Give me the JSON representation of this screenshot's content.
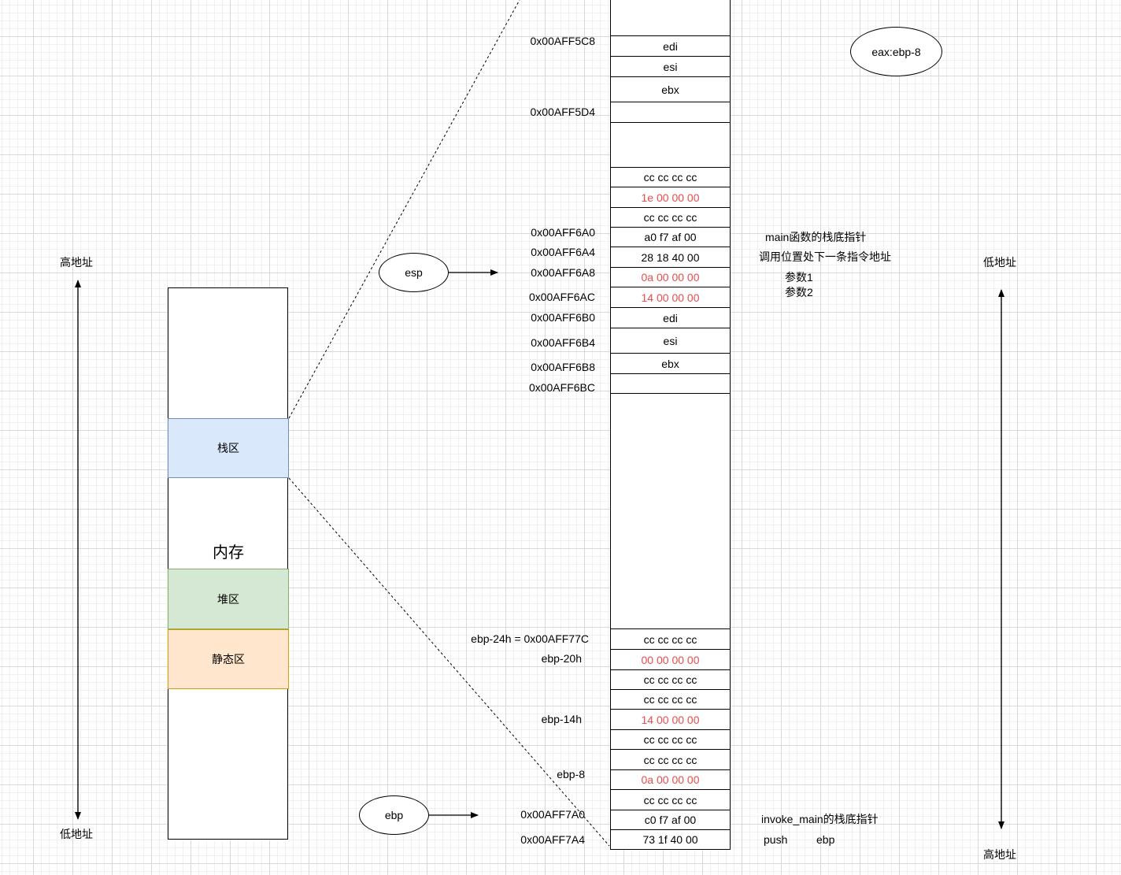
{
  "axis_left": {
    "top_label": "高地址",
    "bottom_label": "低地址"
  },
  "axis_right": {
    "top_label": "低地址",
    "bottom_label": "高地址"
  },
  "memory": {
    "label": "内存",
    "stack_label": "栈区",
    "heap_label": "堆区",
    "static_label": "静态区"
  },
  "eax_note": "eax:ebp-8",
  "esp_label": "esp",
  "ebp_label": "ebp",
  "top_block": {
    "addr_5c8": "0x00AFF5C8",
    "addr_5d4": "0x00AFF5D4",
    "cells": [
      "edi",
      "esi",
      "ebx",
      ""
    ],
    "cc_row_a": "cc cc cc cc",
    "red_row": "1e 00 00 00",
    "cc_row_b": "cc cc cc cc"
  },
  "mid_block": {
    "rows": [
      {
        "addr": "0x00AFF6A0",
        "value": "a0 f7 af 00"
      },
      {
        "addr": "0x00AFF6A4",
        "value": "28 18 40 00"
      },
      {
        "addr": "0x00AFF6A8",
        "value": "0a 00 00 00"
      },
      {
        "addr": "0x00AFF6AC",
        "value": "14 00 00 00"
      },
      {
        "addr": "0x00AFF6B0",
        "value": "edi"
      },
      {
        "addr": "0x00AFF6B4",
        "value": "esi"
      },
      {
        "addr": "0x00AFF6B8",
        "value": "ebx"
      },
      {
        "addr": "0x00AFF6BC",
        "value": ""
      }
    ],
    "note_main_base": "main函数的栈底指针",
    "note_return_addr": "调用位置处下一条指令地址",
    "note_param1": "参数1",
    "note_param2": "参数2"
  },
  "bottom_block": {
    "rows": [
      {
        "label": "ebp-24h = 0x00AFF77C",
        "value": "cc cc cc cc"
      },
      {
        "label": "ebp-20h",
        "value": "00 00 00 00"
      },
      {
        "label": "",
        "value": "cc cc cc cc"
      },
      {
        "label": "",
        "value": "cc cc cc cc"
      },
      {
        "label": "ebp-14h",
        "value": "14 00 00 00"
      },
      {
        "label": "",
        "value": "cc cc cc cc"
      },
      {
        "label": "",
        "value": "cc cc cc cc"
      },
      {
        "label": "ebp-8",
        "value": "0a 00 00 00"
      },
      {
        "label": "",
        "value": "cc cc cc cc"
      },
      {
        "label": "0x00AFF7A0",
        "value": "c0 f7 af 00"
      },
      {
        "label": "0x00AFF7A4",
        "value": "73 1f 40 00"
      }
    ],
    "note_invoke_main": "invoke_main的栈底指针",
    "note_push": "push",
    "note_push_reg": "ebp"
  }
}
